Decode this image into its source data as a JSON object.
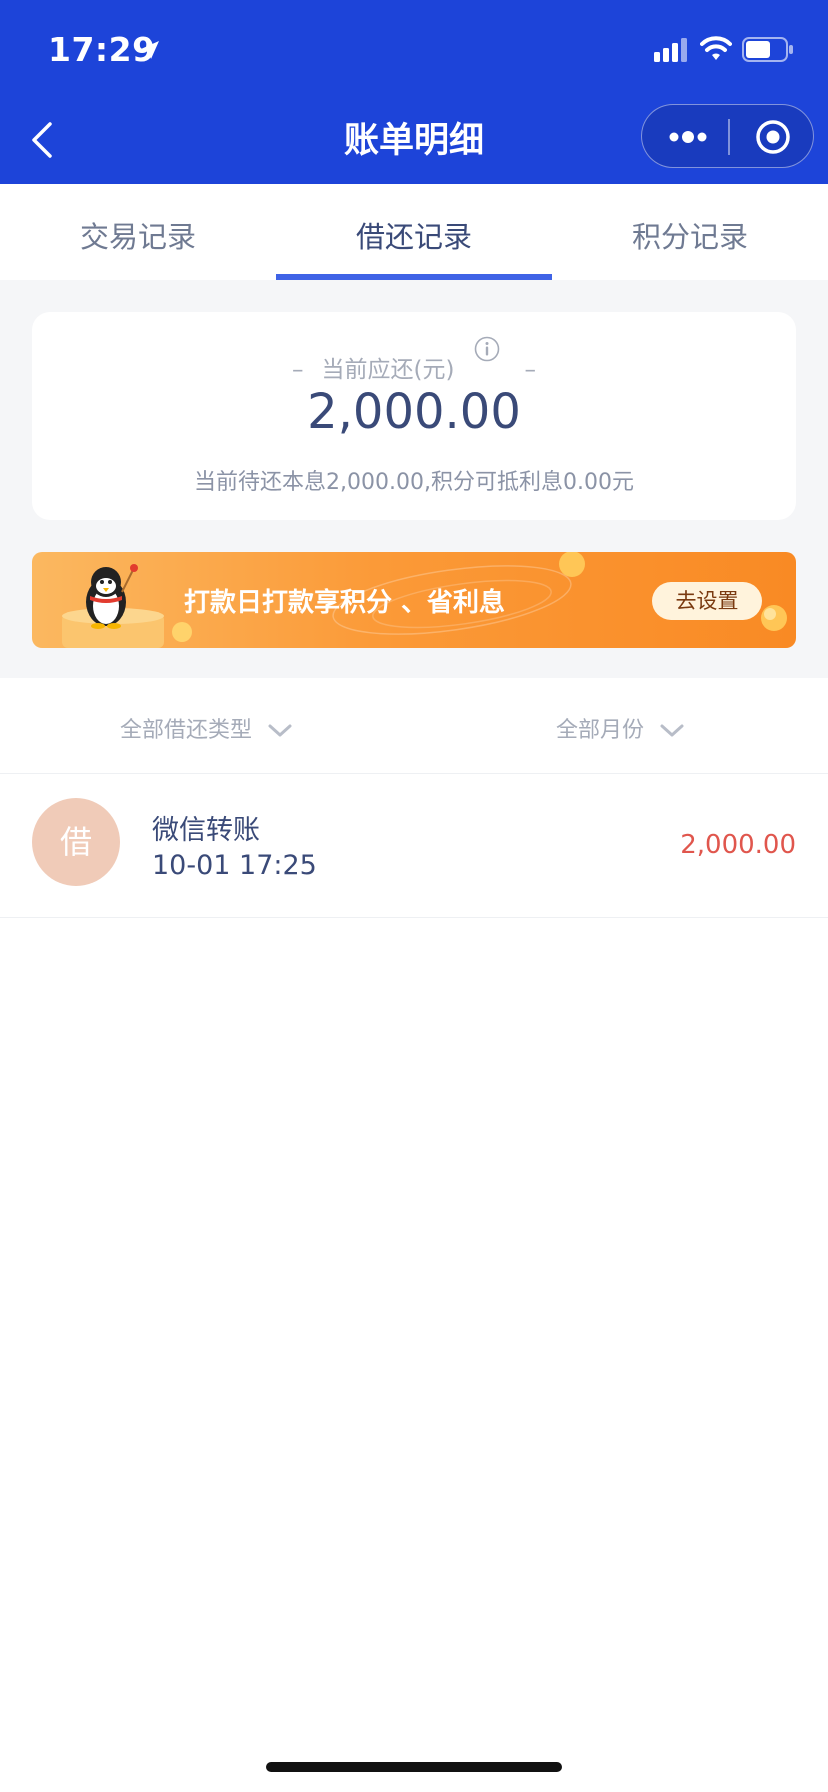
{
  "status_bar": {
    "time": "17:29"
  },
  "nav": {
    "title": "账单明细"
  },
  "tabs": [
    {
      "label": "交易记录",
      "active": false
    },
    {
      "label": "借还记录",
      "active": true
    },
    {
      "label": "积分记录",
      "active": false
    }
  ],
  "summary": {
    "label": "当前应还(元)",
    "amount": "2,000.00",
    "subtitle": "当前待还本息2,000.00,积分可抵利息0.00元"
  },
  "banner": {
    "text": "打款日打款享积分 、省利息",
    "button_label": "去设置"
  },
  "filters": {
    "type_label": "全部借还类型",
    "month_label": "全部月份"
  },
  "records": [
    {
      "badge": "借",
      "title": "微信转账",
      "time": "10-01 17:25",
      "amount": "2,000.00"
    }
  ],
  "colors": {
    "nav_bg": "#1d44d9",
    "tab_active": "#3f63e6",
    "amount_red": "#e0564d",
    "text_primary": "#3a4a78",
    "banner_orange": "#f98a24"
  }
}
